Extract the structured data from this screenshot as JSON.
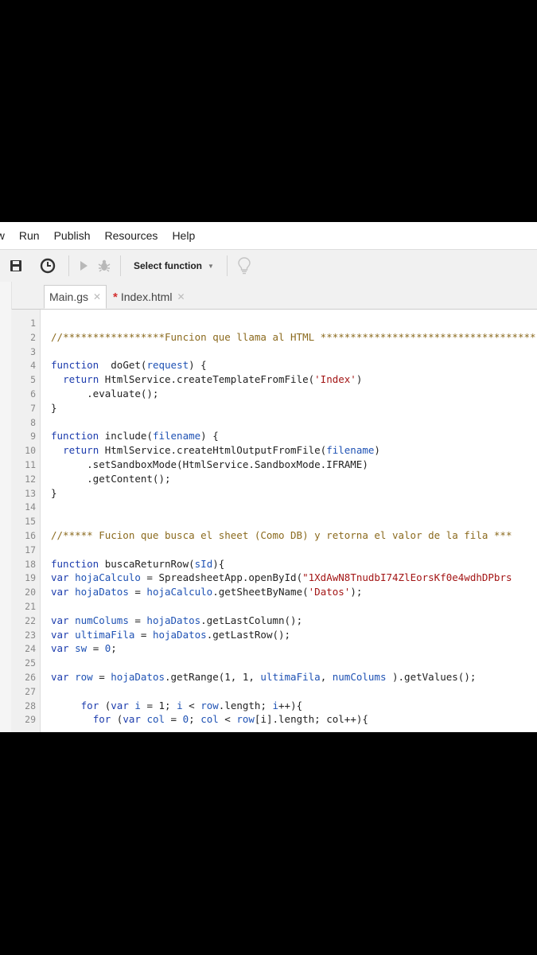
{
  "menu": [
    "ew",
    "Run",
    "Publish",
    "Resources",
    "Help"
  ],
  "toolbar": {
    "select_function_label": "Select function",
    "icons": [
      "save-icon",
      "clock-icon",
      "run-icon",
      "debug-icon",
      "lightbulb-icon"
    ]
  },
  "tabs": [
    {
      "label": "Main.gs",
      "modified": false,
      "active": true
    },
    {
      "label": "Index.html",
      "modified": true,
      "active": false
    }
  ],
  "code_lines": [
    [],
    [
      [
        "cm",
        "//"
      ],
      [
        "cm",
        "*****************Funcion que llama al HTML ************************************"
      ]
    ],
    [],
    [
      [
        "kw",
        "function"
      ],
      [
        "",
        "  doGet("
      ],
      [
        "var",
        "request"
      ],
      [
        "",
        ") {"
      ]
    ],
    [
      [
        "",
        "  "
      ],
      [
        "kw",
        "return"
      ],
      [
        "",
        " HtmlService.createTemplateFromFile("
      ],
      [
        "str",
        "'Index'"
      ],
      [
        "",
        ")"
      ]
    ],
    [
      [
        "",
        "      .evaluate();"
      ]
    ],
    [
      [
        "",
        "}"
      ]
    ],
    [],
    [
      [
        "kw",
        "function"
      ],
      [
        "",
        " include("
      ],
      [
        "var",
        "filename"
      ],
      [
        "",
        ") {"
      ]
    ],
    [
      [
        "",
        "  "
      ],
      [
        "kw",
        "return"
      ],
      [
        "",
        " HtmlService.createHtmlOutputFromFile("
      ],
      [
        "var",
        "filename"
      ],
      [
        "",
        ")"
      ]
    ],
    [
      [
        "",
        "      .setSandboxMode(HtmlService.SandboxMode.IFRAME)"
      ]
    ],
    [
      [
        "",
        "      .getContent();"
      ]
    ],
    [
      [
        "",
        "}"
      ]
    ],
    [],
    [],
    [
      [
        "cm",
        "//***** Fucion que busca el sheet (Como DB) y retorna el valor de la fila ***"
      ]
    ],
    [],
    [
      [
        "kw",
        "function"
      ],
      [
        "",
        " buscaReturnRow("
      ],
      [
        "var",
        "sId"
      ],
      [
        "",
        "){"
      ]
    ],
    [
      [
        "kw",
        "var"
      ],
      [
        "",
        " "
      ],
      [
        "var",
        "hojaCalculo"
      ],
      [
        "",
        " = SpreadsheetApp.openById("
      ],
      [
        "str",
        "\"1XdAwN8TnudbI74ZlEorsKf0e4wdhDPbrs"
      ]
    ],
    [
      [
        "kw",
        "var"
      ],
      [
        "",
        " "
      ],
      [
        "var",
        "hojaDatos"
      ],
      [
        "",
        " = "
      ],
      [
        "var",
        "hojaCalculo"
      ],
      [
        "",
        ".getSheetByName("
      ],
      [
        "str",
        "'Datos'"
      ],
      [
        "",
        ");"
      ]
    ],
    [],
    [
      [
        "kw",
        "var"
      ],
      [
        "",
        " "
      ],
      [
        "var",
        "numColums"
      ],
      [
        "",
        " = "
      ],
      [
        "var",
        "hojaDatos"
      ],
      [
        "",
        ".getLastColumn();"
      ]
    ],
    [
      [
        "kw",
        "var"
      ],
      [
        "",
        " "
      ],
      [
        "var",
        "ultimaFila"
      ],
      [
        "",
        " = "
      ],
      [
        "var",
        "hojaDatos"
      ],
      [
        "",
        ".getLastRow();"
      ]
    ],
    [
      [
        "kw",
        "var"
      ],
      [
        "",
        " "
      ],
      [
        "var",
        "sw"
      ],
      [
        "",
        " = "
      ],
      [
        "num",
        "0"
      ],
      [
        "",
        ";"
      ]
    ],
    [],
    [
      [
        "kw",
        "var"
      ],
      [
        "",
        " "
      ],
      [
        "var",
        "row"
      ],
      [
        "",
        " = "
      ],
      [
        "var",
        "hojaDatos"
      ],
      [
        "",
        ".getRange(1, 1, "
      ],
      [
        "var",
        "ultimaFila"
      ],
      [
        "",
        ", "
      ],
      [
        "var",
        "numColums"
      ],
      [
        "",
        " ).getValues();"
      ]
    ],
    [],
    [
      [
        "",
        "     "
      ],
      [
        "kw",
        "for"
      ],
      [
        "",
        " ("
      ],
      [
        "kw",
        "var"
      ],
      [
        "",
        " "
      ],
      [
        "var",
        "i"
      ],
      [
        "",
        " = 1; "
      ],
      [
        "var",
        "i"
      ],
      [
        "",
        " < "
      ],
      [
        "var",
        "row"
      ],
      [
        "",
        ".length; "
      ],
      [
        "var",
        "i"
      ],
      [
        "",
        "++){"
      ]
    ],
    [
      [
        "",
        "       "
      ],
      [
        "kw",
        "for"
      ],
      [
        "",
        " ("
      ],
      [
        "kw",
        "var"
      ],
      [
        "",
        " "
      ],
      [
        "var",
        "col"
      ],
      [
        "",
        " = "
      ],
      [
        "num",
        "0"
      ],
      [
        "",
        "; "
      ],
      [
        "var",
        "col"
      ],
      [
        "",
        " < "
      ],
      [
        "var",
        "row"
      ],
      [
        "",
        "[i].length; col++){"
      ]
    ]
  ]
}
